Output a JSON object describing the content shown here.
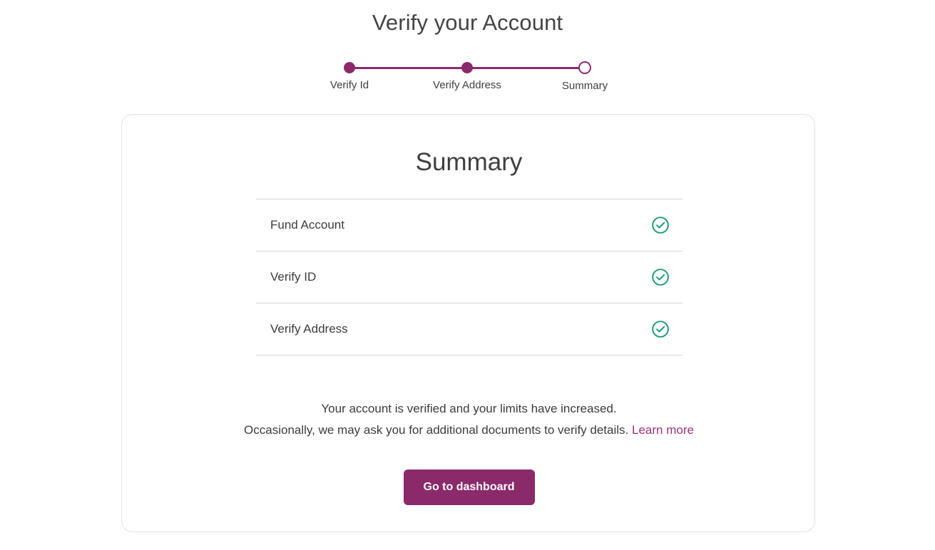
{
  "page": {
    "title": "Verify your Account",
    "background_color": "#ffffff",
    "accent_color": "#8b2a6b",
    "success_color": "#1a9e6f",
    "link_color": "#9b3273"
  },
  "stepper": {
    "steps": [
      {
        "label": "Verify Id",
        "state": "done",
        "icon": "filled-dot-icon"
      },
      {
        "label": "Verify Address",
        "state": "done",
        "icon": "filled-dot-icon"
      },
      {
        "label": "Summary",
        "state": "current",
        "icon": "hollow-dot-icon"
      }
    ]
  },
  "card": {
    "title": "Summary",
    "rows": [
      {
        "label": "Fund Account",
        "status_icon": "check-circle-icon",
        "status": "verified"
      },
      {
        "label": "Verify ID",
        "status_icon": "check-circle-icon",
        "status": "verified"
      },
      {
        "label": "Verify Address",
        "status_icon": "check-circle-icon",
        "status": "verified"
      }
    ],
    "note": {
      "line1": "Your account is verified and your limits have increased.",
      "line2": "Occasionally, we may ask you for additional documents to verify details.",
      "link": "Learn more"
    },
    "cta": {
      "label": "Go to dashboard"
    }
  }
}
